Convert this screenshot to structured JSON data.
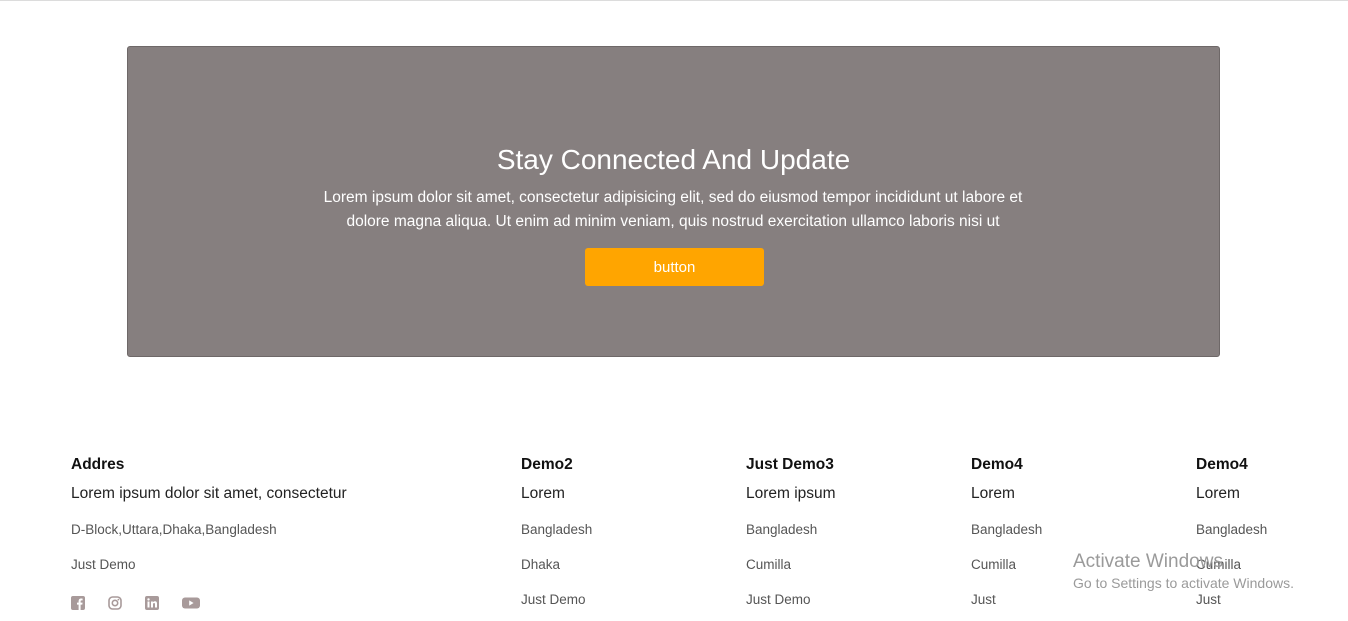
{
  "cta": {
    "title": "Stay Connected And Update",
    "text": "Lorem ipsum dolor sit amet, consectetur adipisicing elit, sed do eiusmod tempor incididunt ut labore et dolore magna aliqua. Ut enim ad minim veniam, quis nostrud exercitation ullamco laboris nisi ut",
    "button_label": "button",
    "background_color": "#867f7f",
    "button_color": "#ffa500"
  },
  "footer": {
    "columns": [
      {
        "title": "Addres",
        "lead": "Lorem ipsum dolor sit amet, consectetur",
        "items": [
          "D-Block,Uttara,Dhaka,Bangladesh",
          "Just Demo"
        ]
      },
      {
        "title": "Demo2",
        "lead": "Lorem",
        "items": [
          "Bangladesh",
          "Dhaka",
          "Just Demo"
        ]
      },
      {
        "title": "Just Demo3",
        "lead": "Lorem ipsum",
        "items": [
          "Bangladesh",
          "Cumilla",
          "Just Demo"
        ]
      },
      {
        "title": "Demo4",
        "lead": "Lorem",
        "items": [
          "Bangladesh",
          "Cumilla",
          "Just"
        ]
      },
      {
        "title": "Demo4",
        "lead": "Lorem",
        "items": [
          "Bangladesh",
          "Cumilla",
          "Just"
        ]
      }
    ],
    "social_icons": [
      "facebook-icon",
      "instagram-icon",
      "linkedin-icon",
      "youtube-icon"
    ],
    "icon_color": "#a89a9a"
  },
  "watermark": {
    "title": "Activate Windows",
    "subtitle": "Go to Settings to activate Windows."
  }
}
